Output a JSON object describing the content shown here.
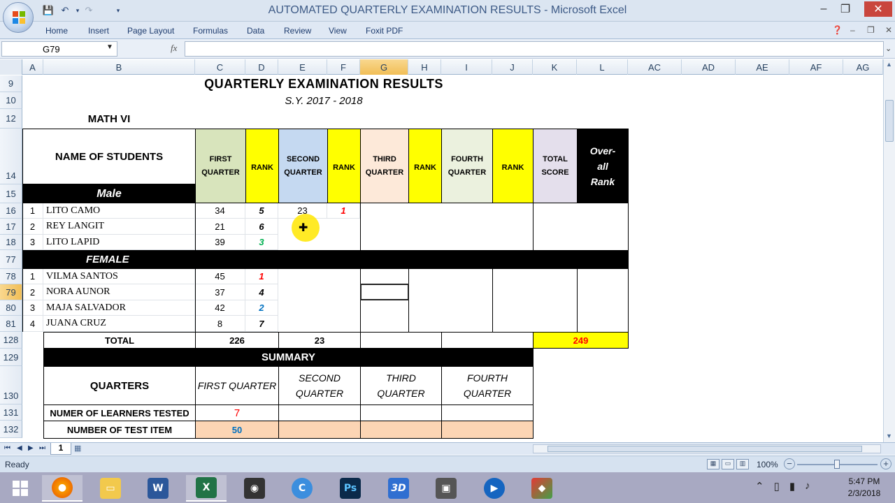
{
  "window": {
    "title": "AUTOMATED QUARTERLY EXAMINATION RESULTS - Microsoft Excel",
    "controls": [
      "–",
      "❐",
      "✕"
    ]
  },
  "ribbon": {
    "tabs": [
      "Home",
      "Insert",
      "Page Layout",
      "Formulas",
      "Data",
      "Review",
      "View",
      "Foxit PDF"
    ]
  },
  "formula_bar": {
    "name_box": "G79",
    "fx": "fx",
    "formula": ""
  },
  "columns": [
    "A",
    "B",
    "C",
    "D",
    "E",
    "F",
    "G",
    "H",
    "I",
    "J",
    "K",
    "L",
    "AC",
    "AD",
    "AE",
    "AF",
    "AG"
  ],
  "rows": [
    "9",
    "10",
    "12",
    "14",
    "15",
    "16",
    "17",
    "18",
    "77",
    "78",
    "79",
    "80",
    "81",
    "128",
    "129",
    "130",
    "131",
    "132"
  ],
  "sheet": {
    "title": "QUARTERLY EXAMINATION RESULTS",
    "school_year": "S.Y. 2017 - 2018",
    "subject": "MATH VI",
    "headers": {
      "name": "NAME OF STUDENTS",
      "first_quarter": "FIRST QUARTER",
      "rank": "RANK",
      "second_quarter": "SECOND QUARTER",
      "third_quarter": "THIRD QUARTER",
      "fourth_quarter": "FOURTH QUARTER",
      "total_score": "TOTAL SCORE",
      "overall_rank": "Over-all Rank"
    },
    "male_label": "Male",
    "female_label": "FEMALE",
    "male": [
      {
        "no": "1",
        "name": "LITO CAMO",
        "q1": "34",
        "r1": "5",
        "q2": "23",
        "r2": "1"
      },
      {
        "no": "2",
        "name": "REY LANGIT",
        "q1": "21",
        "r1": "6",
        "q2": "",
        "r2": ""
      },
      {
        "no": "3",
        "name": "LITO LAPID",
        "q1": "39",
        "r1": "3",
        "q2": "",
        "r2": ""
      }
    ],
    "female": [
      {
        "no": "1",
        "name": "VILMA SANTOS",
        "q1": "45",
        "r1": "1"
      },
      {
        "no": "2",
        "name": "NORA AUNOR",
        "q1": "37",
        "r1": "4"
      },
      {
        "no": "3",
        "name": "MAJA SALVADOR",
        "q1": "42",
        "r1": "2"
      },
      {
        "no": "4",
        "name": "JUANA CRUZ",
        "q1": "8",
        "r1": "7"
      }
    ],
    "total": {
      "label": "TOTAL",
      "q1": "226",
      "q2": "23",
      "grand": "249"
    },
    "summary": {
      "title": "SUMMARY",
      "quarters_label": "QUARTERS",
      "q1": "FIRST QUARTER",
      "q2": "SECOND QUARTER",
      "q3": "THIRD QUARTER",
      "q4": "FOURTH QUARTER",
      "learners_label": "NUMER OF LEARNERS TESTED",
      "learners_q1": "7",
      "items_label": "NUMBER OF TEST ITEM",
      "items_q1": "50"
    }
  },
  "sheet_tab": "1",
  "status": {
    "ready": "Ready",
    "zoom": "100%"
  },
  "taskbar": {
    "time": "5:47 PM",
    "date": "2/3/2018"
  },
  "colors": {
    "q1_fill": "#d8e4bc",
    "q2_fill": "#c5d9f1",
    "q3_fill": "#fde9d9",
    "q4_fill": "#ebf1de",
    "total_fill": "#e4dfec",
    "rank_fill": "#ffff00",
    "summary_item_fill": "#fcd5b4",
    "rank_red": "#ff0000",
    "rank_green": "#00b050",
    "rank_blue": "#0070c0"
  }
}
